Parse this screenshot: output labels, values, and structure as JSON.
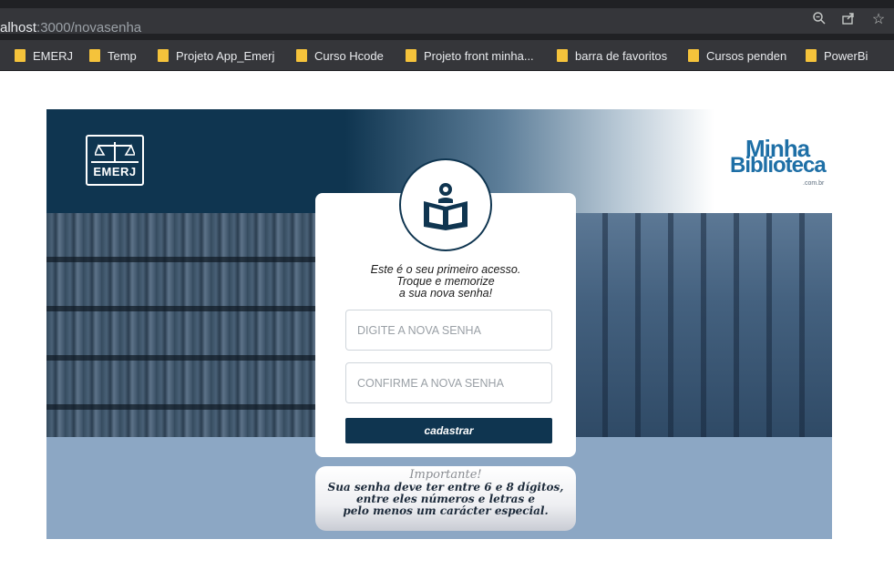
{
  "browser": {
    "url_host": "alhost",
    "url_rest": ":3000/novasenha",
    "icons": [
      "zoom-icon",
      "share-icon",
      "star-icon"
    ]
  },
  "bookmarks": [
    {
      "label": "EMERJ"
    },
    {
      "label": "Temp"
    },
    {
      "label": "Projeto App_Emerj"
    },
    {
      "label": "Curso Hcode"
    },
    {
      "label": "Projeto front minha..."
    },
    {
      "label": "barra de favoritos"
    },
    {
      "label": "Cursos penden"
    },
    {
      "label": "PowerBi"
    }
  ],
  "header": {
    "emerj_logo_text": "EMERJ",
    "mb_logo_line1": "Minha",
    "mb_logo_line2": "Biblioteca",
    "mb_logo_line3": ".com.br"
  },
  "card": {
    "message_line1": "Este é o seu primeiro acesso.",
    "message_line2": "Troque e memorize",
    "message_line3": "a sua nova senha!",
    "new_password_placeholder": "DIGITE A NOVA SENHA",
    "confirm_password_placeholder": "CONFIRME A NOVA SENHA",
    "submit_label": "cadastrar"
  },
  "notice": {
    "title": "Importante!",
    "line1": "Sua senha deve ter entre 6 e 8 dígitos,",
    "line2": "entre eles números e letras e",
    "line3": "pelo menos um carácter especial."
  },
  "colors": {
    "primary": "#0f3550",
    "background": "#8ca7c4",
    "brand_blue": "#1e6fa6"
  }
}
